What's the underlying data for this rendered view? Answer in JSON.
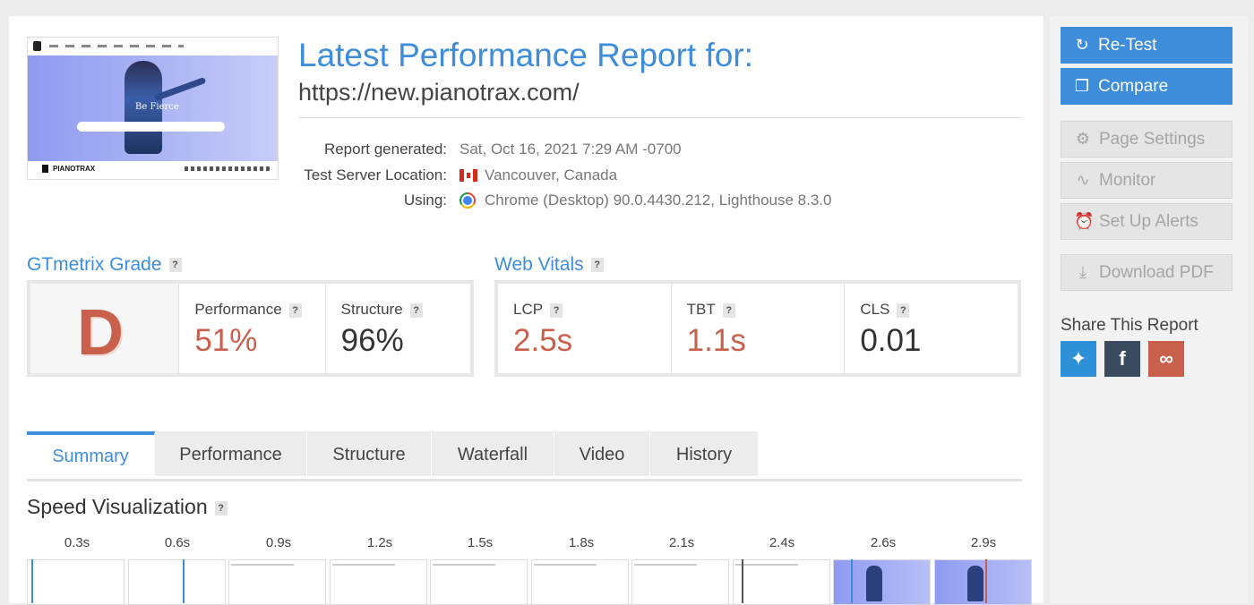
{
  "report": {
    "title": "Latest Performance Report for:",
    "url": "https://new.pianotrax.com/",
    "meta": [
      {
        "label": "Report generated:",
        "value": "Sat, Oct 16, 2021 7:29 AM -0700"
      },
      {
        "label": "Test Server Location:",
        "value": "Vancouver, Canada"
      },
      {
        "label": "Using:",
        "value": "Chrome (Desktop) 90.0.4430.212, Lighthouse 8.3.0"
      }
    ]
  },
  "thumbnail": {
    "hero_text": "Be Fierce",
    "brand": "PIANOTRAX"
  },
  "grade": {
    "heading": "GTmetrix Grade",
    "help": "?",
    "letter": "D",
    "performance_label": "Performance",
    "performance_value": "51%",
    "structure_label": "Structure",
    "structure_value": "96%"
  },
  "vitals": {
    "heading": "Web Vitals",
    "help": "?",
    "items": [
      {
        "label": "LCP",
        "value": "2.5s",
        "color": "#c9604c"
      },
      {
        "label": "TBT",
        "value": "1.1s",
        "color": "#c9604c"
      },
      {
        "label": "CLS",
        "value": "0.01",
        "color": "#333333"
      }
    ]
  },
  "tabs": [
    "Summary",
    "Performance",
    "Structure",
    "Waterfall",
    "Video",
    "History"
  ],
  "active_tab": "Summary",
  "speed": {
    "title": "Speed Visualization",
    "help": "?",
    "ticks": [
      "0.3s",
      "0.6s",
      "0.9s",
      "1.2s",
      "1.5s",
      "1.8s",
      "2.1s",
      "2.4s",
      "2.6s",
      "2.9s"
    ]
  },
  "sidebar": {
    "retest": "Re-Test",
    "compare": "Compare",
    "page_settings": "Page Settings",
    "monitor": "Monitor",
    "alerts": "Set Up Alerts",
    "download": "Download PDF",
    "share_title": "Share This Report"
  },
  "colors": {
    "accent": "#3d8ddb",
    "bad": "#c9604c",
    "twitter": "#2d8fd5",
    "facebook": "#3a4b60",
    "link": "#c9604c"
  }
}
